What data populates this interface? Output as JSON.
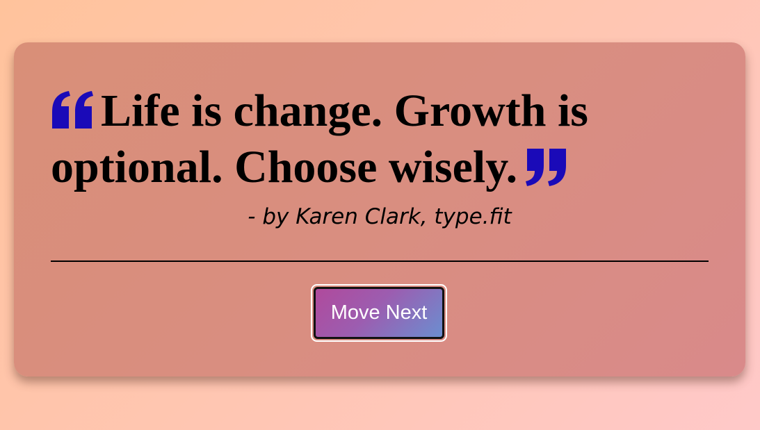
{
  "quote": {
    "text": "Life is change. Growth is optional. Choose wisely.",
    "open_icon": "quote-left-icon",
    "close_icon": "quote-right-icon",
    "icon_color": "#1a0ab8"
  },
  "author": {
    "text": "- by Karen Clark, type.fit"
  },
  "actions": {
    "next_label": "Move Next"
  }
}
